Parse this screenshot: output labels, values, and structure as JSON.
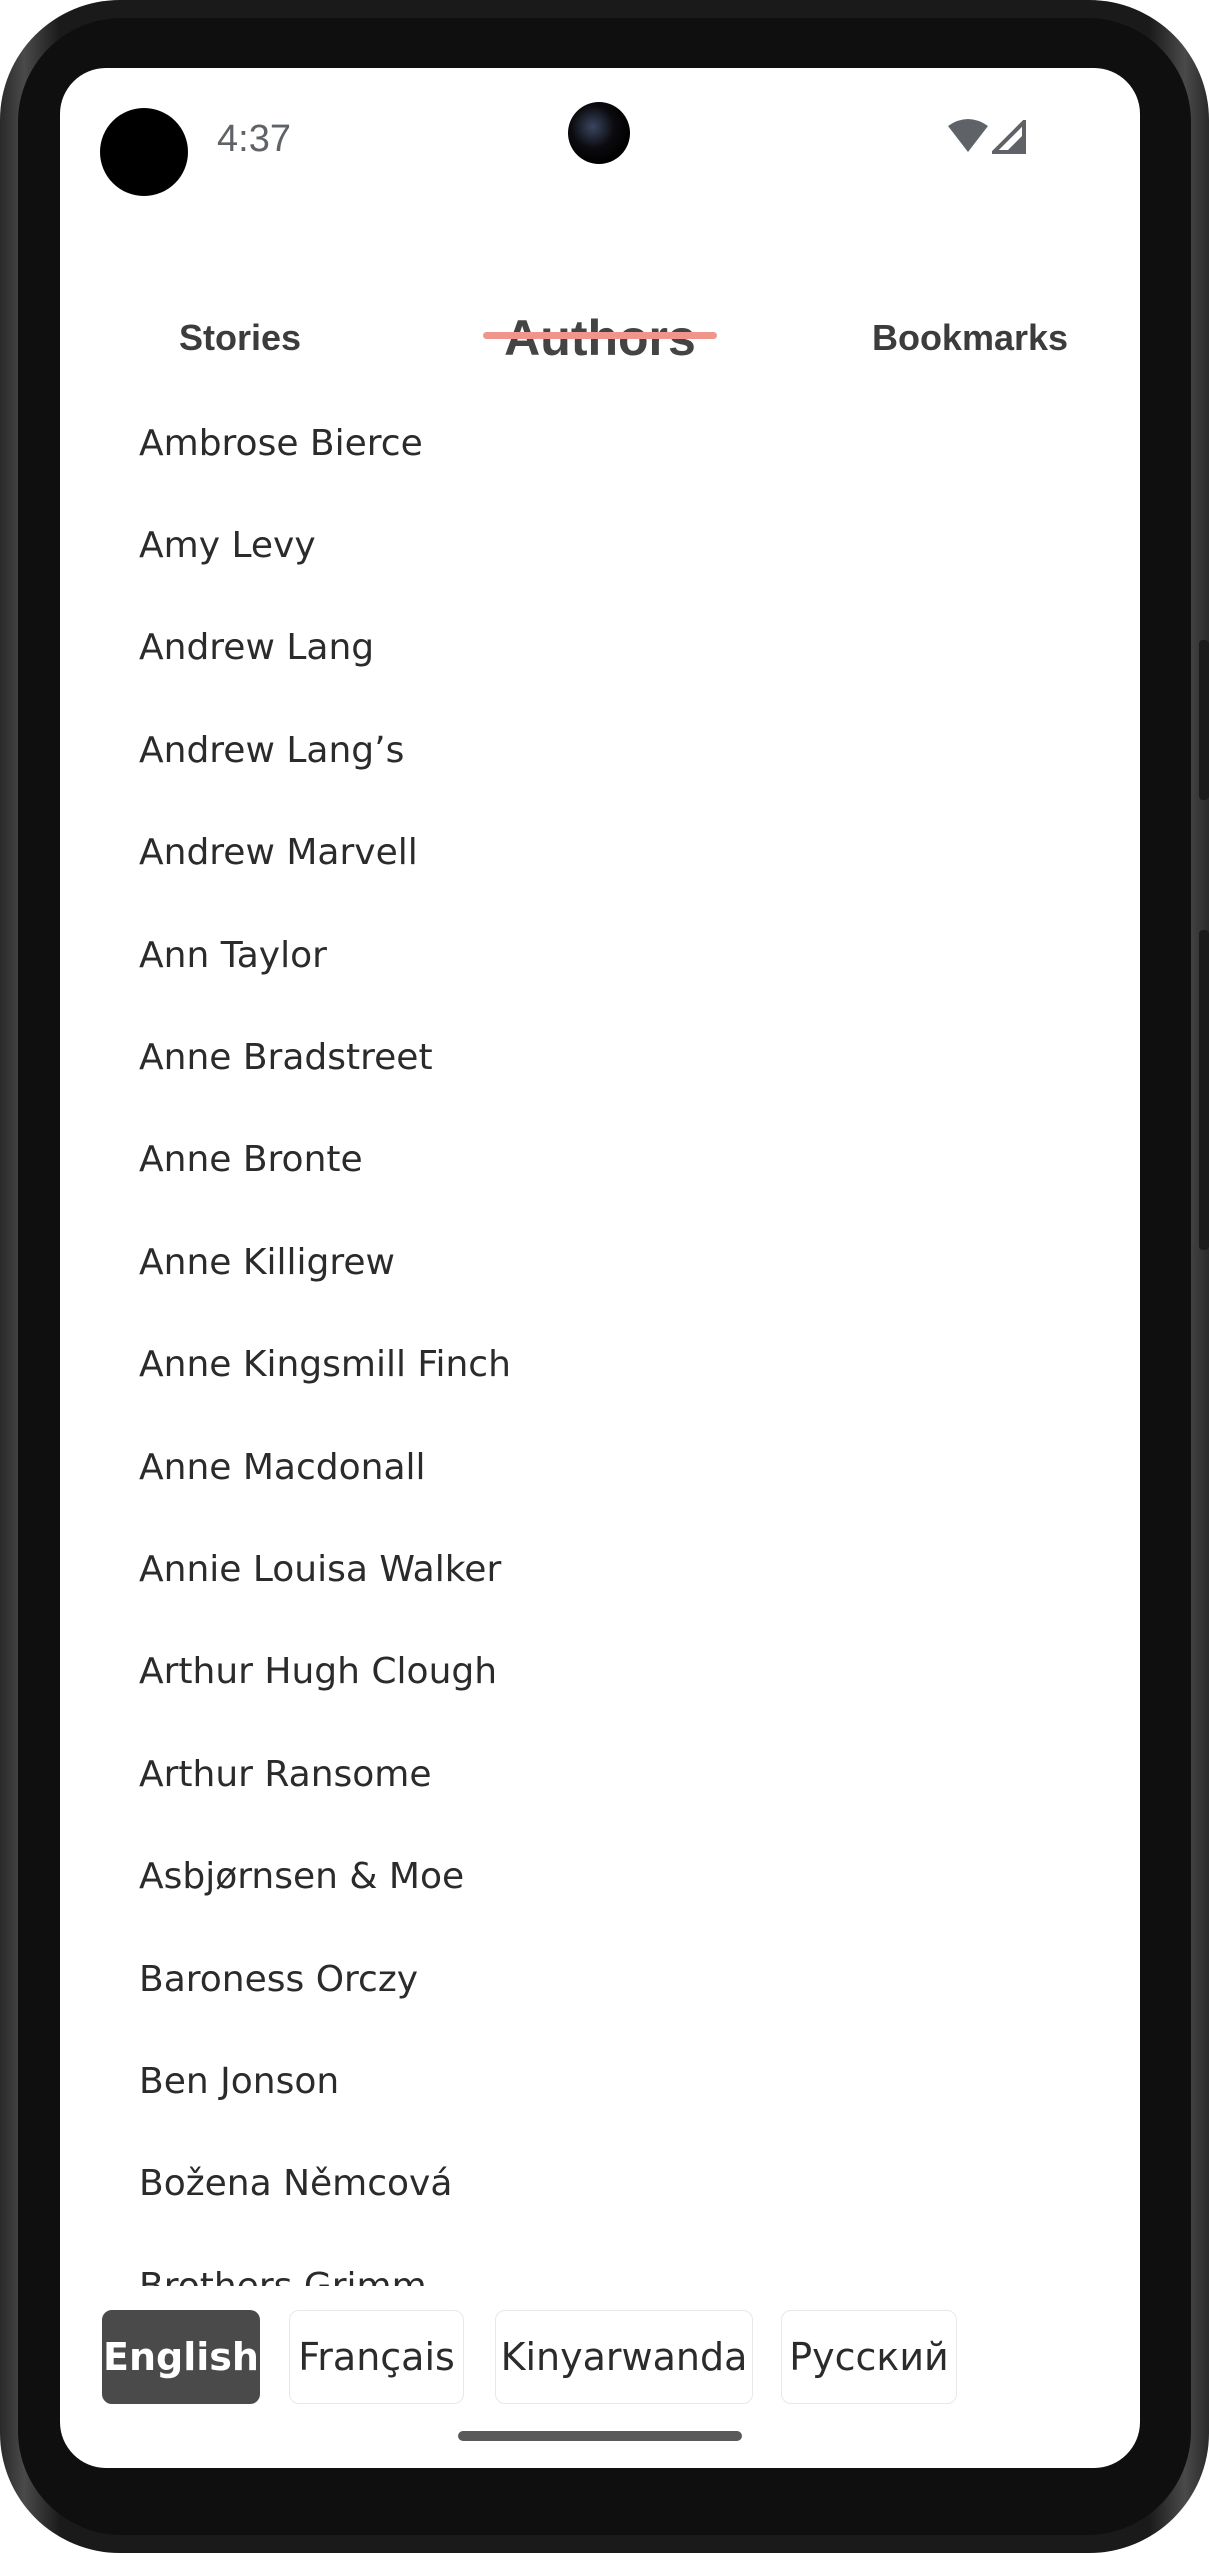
{
  "status_bar": {
    "time": "4:37"
  },
  "tabs": {
    "stories": "Stories",
    "authors": "Authors",
    "bookmarks": "Bookmarks",
    "active": "Authors"
  },
  "authors": [
    "Ambrose Bierce",
    "Amy Levy",
    "Andrew Lang",
    "Andrew Lang’s",
    "Andrew Marvell",
    "Ann Taylor",
    "Anne Bradstreet",
    "Anne Bronte",
    "Anne Killigrew",
    "Anne Kingsmill Finch",
    "Anne Macdonall",
    "Annie Louisa Walker",
    "Arthur Hugh Clough",
    "Arthur Ransome",
    "Asbjørnsen & Moe",
    "Baroness Orczy",
    "Ben Jonson",
    "Božena Němcová",
    "Brothers Grimm"
  ],
  "languages": {
    "english": "English",
    "french": "Français",
    "kinyarwanda": "Kinyarwanda",
    "russian": "Русский",
    "selected": "English"
  },
  "colors": {
    "tab_indicator": "#f0958c",
    "active_chip_bg": "#4a4a4a",
    "text": "#2b2b2b"
  },
  "icons": [
    "wifi-icon",
    "cell-signal-icon"
  ]
}
